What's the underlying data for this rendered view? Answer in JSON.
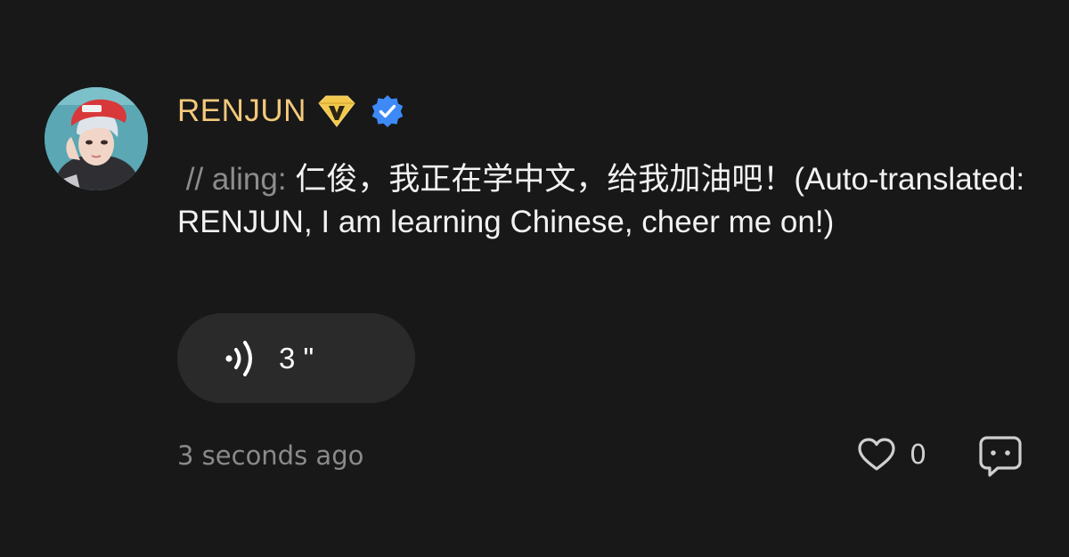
{
  "comment": {
    "username": "RENJUN",
    "badge_icon": "gold-v-badge-icon",
    "verified_icon": "verified-check-icon",
    "reply_prefix": " // aling: ",
    "text": "仁俊，我正在学中文，给我加油吧！(Auto-translated: RENJUN, I am learning Chinese, cheer me on!)",
    "voice_duration": "3 \"",
    "timestamp": "3 seconds ago",
    "like_count": "0"
  },
  "colors": {
    "background": "#181818",
    "username": "#f3c97b",
    "badge_gold": "#f2c94c",
    "verified_blue": "#3d8af7",
    "pill": "#2a2a2a",
    "muted_text": "#8a8a8a"
  },
  "icons": {
    "audio": "sound-wave-icon",
    "like": "heart-outline-icon",
    "reply": "chat-bubble-icon"
  }
}
